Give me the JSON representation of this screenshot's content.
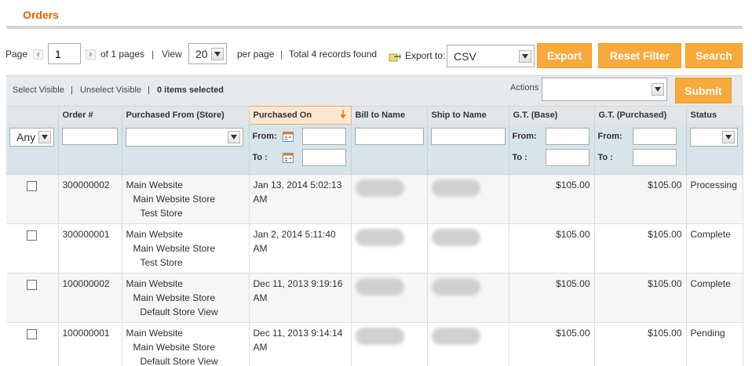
{
  "header": {
    "title": "Orders"
  },
  "pager": {
    "page_label": "Page",
    "page_value": "1",
    "of_pages": "of 1 pages",
    "view_label": "View",
    "view_value": "20",
    "per_page": "per page",
    "total": "Total 4 records found",
    "export_label": "Export to:",
    "export_value": "CSV",
    "export_btn": "Export",
    "reset_btn": "Reset Filter",
    "search_btn": "Search",
    "sep": "|"
  },
  "mass": {
    "select_visible": "Select Visible",
    "unselect_visible": "Unselect Visible",
    "items_selected": "0 items selected",
    "actions_label": "Actions",
    "submit_btn": "Submit",
    "sep": "|"
  },
  "columns": [
    "Order #",
    "Purchased From (Store)",
    "Purchased On",
    "Bill to Name",
    "Ship to Name",
    "G.T. (Base)",
    "G.T. (Purchased)",
    "Status"
  ],
  "filters": {
    "any": "Any",
    "from": "From:",
    "to": "To :"
  },
  "rows": [
    {
      "order": "300000002",
      "store": [
        "Main Website",
        "Main Website Store",
        "Test Store"
      ],
      "date1": "Jan 13, 2014 5:02:13",
      "date2": "AM",
      "gt_base": "$105.00",
      "gt_purchased": "$105.00",
      "status": "Processing"
    },
    {
      "order": "300000001",
      "store": [
        "Main Website",
        "Main Website Store",
        "Test Store"
      ],
      "date1": "Jan 2, 2014 5:11:40",
      "date2": "AM",
      "gt_base": "$105.00",
      "gt_purchased": "$105.00",
      "status": "Complete"
    },
    {
      "order": "100000002",
      "store": [
        "Main Website",
        "Main Website Store",
        "Default Store View"
      ],
      "date1": "Dec 11, 2013 9:19:16",
      "date2": "AM",
      "gt_base": "$105.00",
      "gt_purchased": "$105.00",
      "status": "Complete"
    },
    {
      "order": "100000001",
      "store": [
        "Main Website",
        "Main Website Store",
        "Default Store View"
      ],
      "date1": "Dec 11, 2013 9:14:14",
      "date2": "AM",
      "gt_base": "$105.00",
      "gt_purchased": "$105.00",
      "status": "Pending"
    }
  ],
  "colors": {
    "accent": "#eb5e00",
    "button": "#f8a93c",
    "filter_bg": "#d7e5ea",
    "sorted_header": "#fde8cf"
  },
  "icons": {
    "calendar": "calendar-icon",
    "export": "export-icon",
    "sort": "sort-arrow-down-icon",
    "prev": "prev-page-icon",
    "next": "next-page-icon"
  }
}
